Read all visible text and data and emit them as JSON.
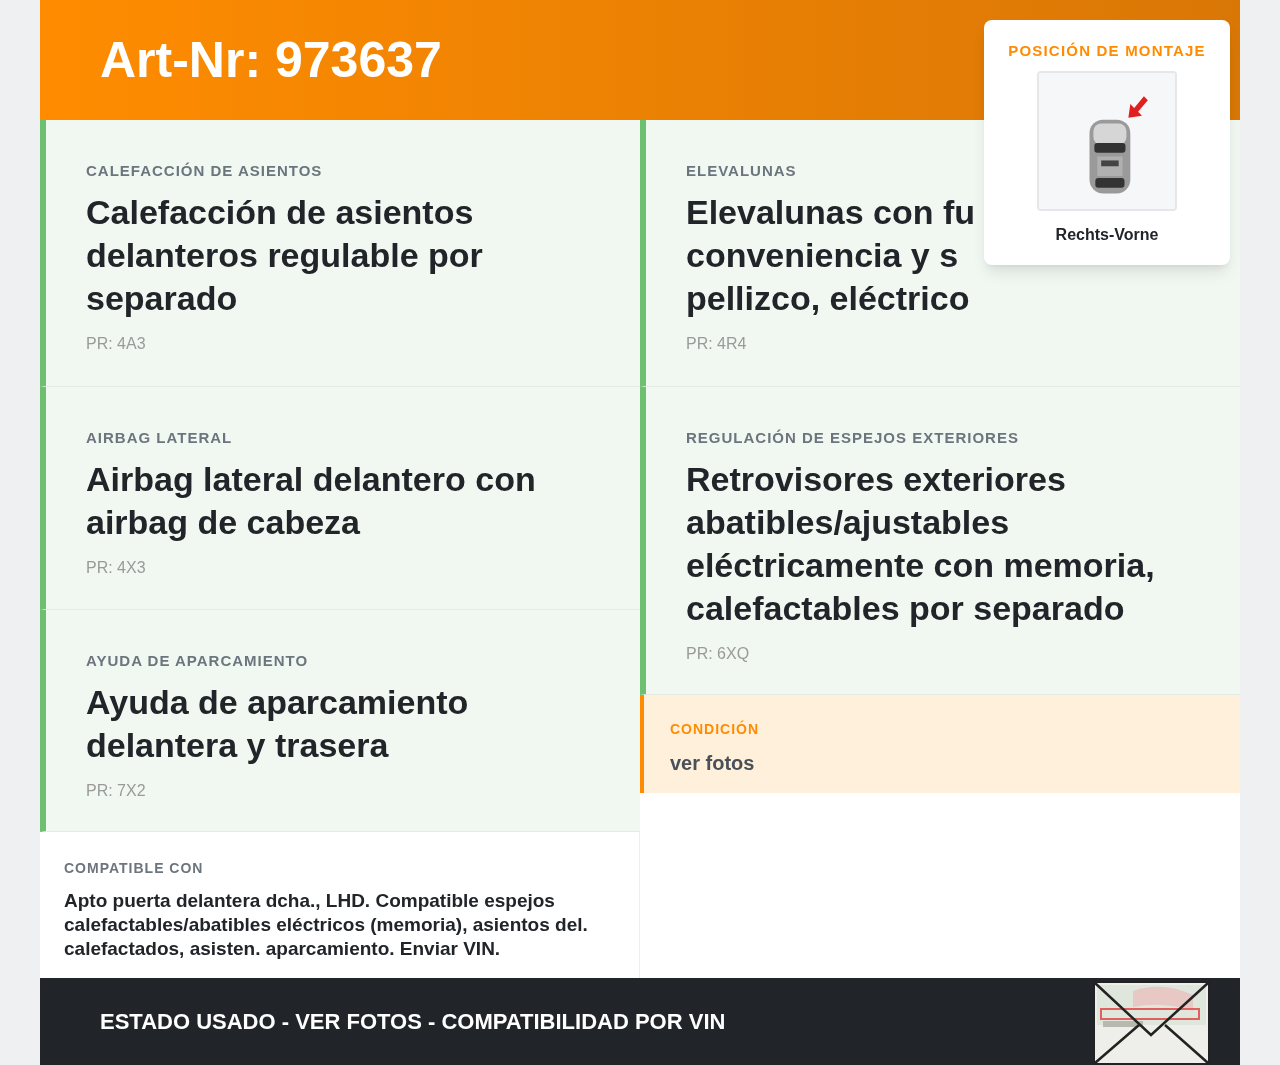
{
  "header": {
    "title": "Art-Nr: 973637"
  },
  "mounting_position": {
    "label": "POSICIÓN DE MONTAJE",
    "position": "Rechts-Vorne"
  },
  "left_features": [
    {
      "category": "CALEFACCIÓN DE ASIENTOS",
      "title_lines": [
        "Calefacción de asientos",
        "delanteros regulable por",
        "separado"
      ],
      "code": "PR: 4A3"
    },
    {
      "category": "AIRBAG LATERAL",
      "title_lines": [
        "Airbag lateral delantero con",
        "airbag de cabeza"
      ],
      "code": "PR: 4X3"
    },
    {
      "category": "AYUDA DE APARCAMIENTO",
      "title_lines": [
        "Ayuda de aparcamiento",
        "delantera y trasera"
      ],
      "code": "PR: 7X2"
    }
  ],
  "right_features": [
    {
      "category": "ELEVALUNAS",
      "title_lines": [
        "Elevalunas con fu",
        "conveniencia y s",
        "pellizco, eléctrico"
      ],
      "code": "PR: 4R4"
    },
    {
      "category": "REGULACIÓN DE ESPEJOS EXTERIORES",
      "title_lines": [
        "Retrovisores exteriores",
        "abatibles/ajustables",
        "eléctricamente con memoria,",
        "calefactables por separado"
      ],
      "code": "PR: 6XQ"
    }
  ],
  "condition": {
    "label": "CONDICIÓN",
    "value": "ver fotos"
  },
  "compatibility": {
    "label": "COMPATIBLE CON",
    "text": "Apto puerta delantera dcha., LHD. Compatible espejos calefactables/abatibles eléctricos (memoria), asientos del. calefactados, asisten. aparcamiento. Enviar VIN."
  },
  "footer": {
    "text": "ESTADO USADO - VER FOTOS - COMPATIBILIDAD POR VIN"
  }
}
